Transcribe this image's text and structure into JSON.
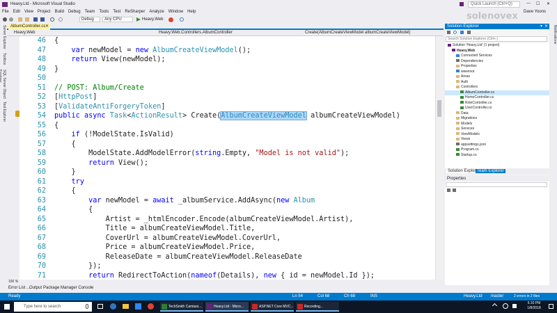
{
  "title_bar": {
    "title": "Heavy.Ltd - Microsoft Visual Studio",
    "quick_launch": "Quick Launch (Ctrl+Q)",
    "user": "Dave Yoons"
  },
  "menu": [
    "File",
    "Edit",
    "View",
    "Project",
    "Build",
    "Debug",
    "Team",
    "Tools",
    "Test",
    "ReSharper",
    "Analyze",
    "Window",
    "Help"
  ],
  "toolbar": {
    "config": "Debug",
    "platform": "Any CPU",
    "run_target": "Heavy.Web"
  },
  "left_tabs": [
    "Server Explorer",
    "Toolbox",
    "SQL Server Object Explorer",
    "Test Explorer"
  ],
  "right_tab": "Notifications",
  "editor": {
    "tab": "AlbumController.cs",
    "nav": {
      "project": "Heavy.Web",
      "class": "Heavy.Web.Controllers.AlbumController",
      "member": "Create(AlbumCreateViewModel albumCreateViewModel)"
    },
    "lines": [
      {
        "n": "46",
        "c": "{"
      },
      {
        "n": "47",
        "c": "    var newModel = new AlbumCreateViewModel();"
      },
      {
        "n": "48",
        "c": "    return View(newModel);"
      },
      {
        "n": "49",
        "c": "}"
      },
      {
        "n": "50",
        "c": ""
      },
      {
        "n": "51",
        "c": "// POST: Album/Create"
      },
      {
        "n": "52",
        "c": "[HttpPost]"
      },
      {
        "n": "53",
        "c": "[ValidateAntiForgeryToken]"
      },
      {
        "n": "54",
        "c": "public async Task<ActionResult> Create(AlbumCreateViewModel albumCreateViewModel)"
      },
      {
        "n": "55",
        "c": "{"
      },
      {
        "n": "56",
        "c": "    if (!ModelState.IsValid)"
      },
      {
        "n": "57",
        "c": "    {"
      },
      {
        "n": "58",
        "c": "        ModelState.AddModelError(string.Empty, \"Model is not valid\");"
      },
      {
        "n": "59",
        "c": "        return View();"
      },
      {
        "n": "60",
        "c": "    }"
      },
      {
        "n": "61",
        "c": "    try"
      },
      {
        "n": "62",
        "c": "    {"
      },
      {
        "n": "63",
        "c": "        var newModel = await _albumService.AddAsync(new Album"
      },
      {
        "n": "64",
        "c": "        {"
      },
      {
        "n": "65",
        "c": "            Artist = _htmlEncoder.Encode(albumCreateViewModel.Artist),"
      },
      {
        "n": "66",
        "c": "            Title = albumCreateViewModel.Title,"
      },
      {
        "n": "67",
        "c": "            CoverUrl = albumCreateViewModel.CoverUrl,"
      },
      {
        "n": "68",
        "c": "            Price = albumCreateViewModel.Price,"
      },
      {
        "n": "69",
        "c": "            ReleaseDate = albumCreateViewModel.ReleaseDate"
      },
      {
        "n": "70",
        "c": "        });"
      },
      {
        "n": "71",
        "c": "        return RedirectToAction(nameof(Details), new { id = newModel.Id });"
      }
    ],
    "zoom": "100 %"
  },
  "solution_explorer": {
    "title": "Solution Explorer",
    "search": "Search Solution Explorer (Ctrl+;)",
    "items": [
      {
        "label": "Solution 'Heavy.Ltd' (1 project)",
        "d": 0,
        "c": "#68217a"
      },
      {
        "label": "Heavy.Web",
        "d": 1,
        "c": "#68217a",
        "bold": true
      },
      {
        "label": "Connected Services",
        "d": 2,
        "c": "#3b7dd8"
      },
      {
        "label": "Dependencies",
        "d": 2,
        "c": "#6d6d6d"
      },
      {
        "label": "Properties",
        "d": 2,
        "c": "#dcb67a"
      },
      {
        "label": "wwwroot",
        "d": 2,
        "c": "#3b7dd8"
      },
      {
        "label": "Areas",
        "d": 2,
        "c": "#dcb67a"
      },
      {
        "label": "Auth",
        "d": 2,
        "c": "#dcb67a"
      },
      {
        "label": "Controllers",
        "d": 2,
        "c": "#dcb67a"
      },
      {
        "label": "AlbumController.cs",
        "d": 3,
        "c": "#388a34",
        "sel": true
      },
      {
        "label": "HomeController.cs",
        "d": 3,
        "c": "#388a34"
      },
      {
        "label": "RoleController.cs",
        "d": 3,
        "c": "#388a34"
      },
      {
        "label": "UserController.cs",
        "d": 3,
        "c": "#388a34"
      },
      {
        "label": "Data",
        "d": 2,
        "c": "#dcb67a"
      },
      {
        "label": "Migrations",
        "d": 2,
        "c": "#dcb67a"
      },
      {
        "label": "Models",
        "d": 2,
        "c": "#dcb67a"
      },
      {
        "label": "Services",
        "d": 2,
        "c": "#dcb67a"
      },
      {
        "label": "ViewModels",
        "d": 2,
        "c": "#dcb67a"
      },
      {
        "label": "Views",
        "d": 2,
        "c": "#dcb67a"
      },
      {
        "label": "appsettings.json",
        "d": 2,
        "c": "#6d6d6d"
      },
      {
        "label": "Program.cs",
        "d": 2,
        "c": "#388a34"
      },
      {
        "label": "Startup.cs",
        "d": 2,
        "c": "#388a34"
      }
    ],
    "tabs": [
      "Solution Explorer",
      "Team Explorer"
    ]
  },
  "properties": {
    "title": "Properties"
  },
  "bottom_tabs": [
    "Error List ...",
    "Output",
    "Package Manager Console"
  ],
  "status": {
    "left": "Ready",
    "ln": "Ln 54",
    "col": "Col 68",
    "ch": "Ch 68",
    "ins": "INS",
    "project": "Heavy.Ltd",
    "branch": "master",
    "changes": "2 errors in 2 files"
  },
  "taskbar": {
    "search": "Type here to search",
    "apps": [
      {
        "label": "TechSmith Camtasi...",
        "c": "#2e7d32"
      },
      {
        "label": "Heavy.Ltd - Micro...",
        "c": "#68217a"
      },
      {
        "label": "ASP.NET Core MVC...",
        "c": "#c62828"
      },
      {
        "label": "Recording...",
        "c": "#c62828"
      }
    ],
    "time": "6:10 PM",
    "date": "1/8/2018"
  },
  "watermark": "solenovex",
  "colors": {
    "vs_purple": "#68217a",
    "status_blue": "#007acc",
    "highlight": "#add6ff"
  }
}
